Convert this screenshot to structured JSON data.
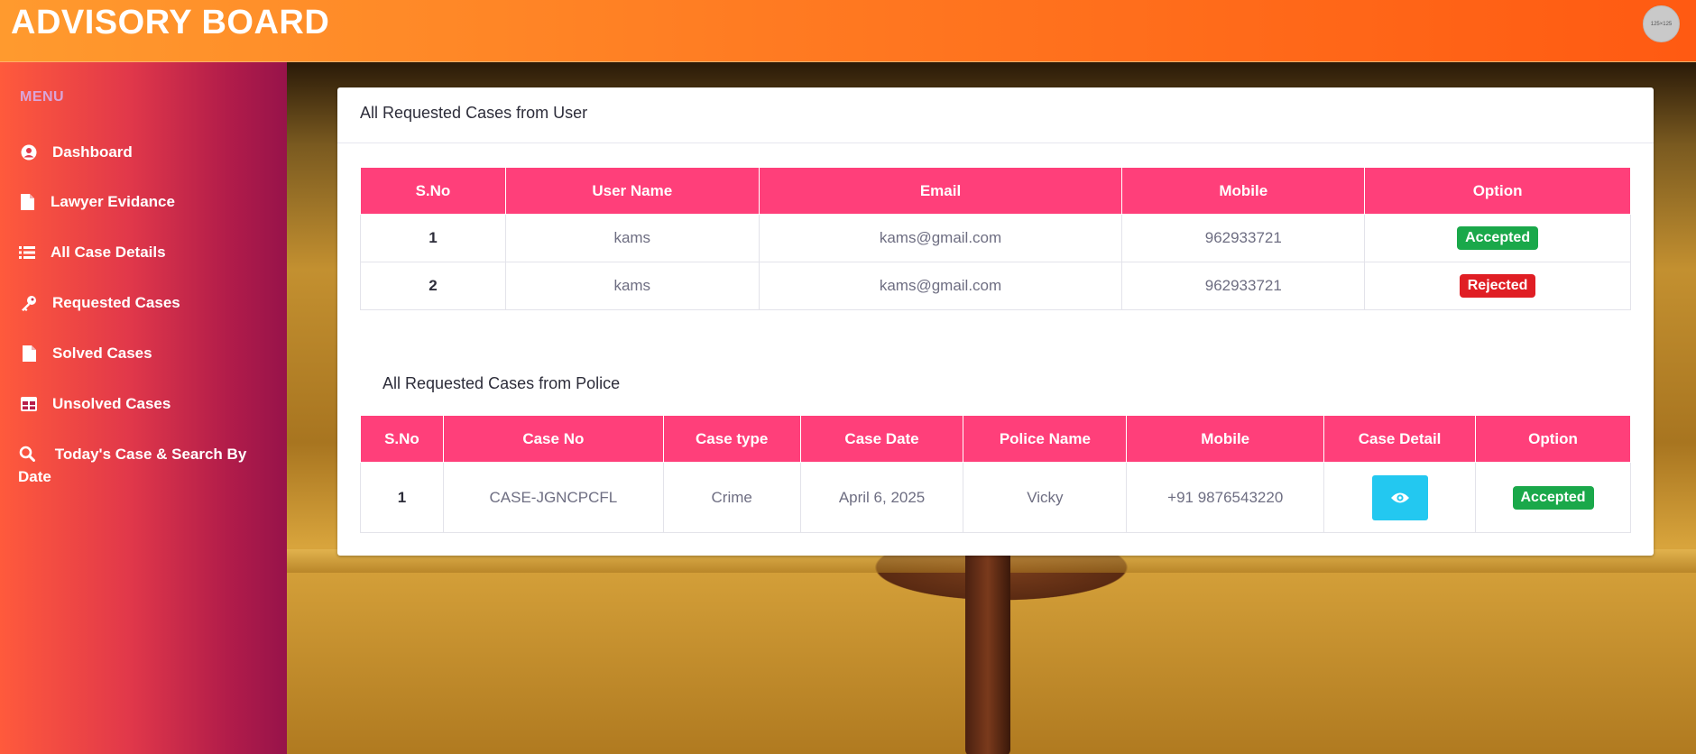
{
  "header": {
    "brand": "ADVISORY BOARD",
    "avatar_text": "125×125"
  },
  "sidebar": {
    "menu_title": "MENU",
    "items": [
      {
        "label": "Dashboard",
        "icon": "user-circle-icon"
      },
      {
        "label": "Lawyer Evidance",
        "icon": "file-icon"
      },
      {
        "label": "All Case Details",
        "icon": "list-icon"
      },
      {
        "label": "Requested Cases",
        "icon": "key-icon"
      },
      {
        "label": "Solved Cases",
        "icon": "file-icon"
      },
      {
        "label": "Unsolved Cases",
        "icon": "table-icon"
      },
      {
        "label": "Today's Case & Search By Date",
        "icon": "search-icon"
      }
    ]
  },
  "main": {
    "card_title": "All Requested Cases from User",
    "user_table": {
      "columns": [
        "S.No",
        "User Name",
        "Email",
        "Mobile",
        "Option"
      ],
      "rows": [
        {
          "sno": "1",
          "name": "kams",
          "email": "kams@gmail.com",
          "mobile": "962933721",
          "option": "Accepted",
          "option_status": "accepted"
        },
        {
          "sno": "2",
          "name": "kams",
          "email": "kams@gmail.com",
          "mobile": "962933721",
          "option": "Rejected",
          "option_status": "rejected"
        }
      ]
    },
    "police_title": "All Requested Cases from Police",
    "police_table": {
      "columns": [
        "S.No",
        "Case No",
        "Case type",
        "Case Date",
        "Police Name",
        "Mobile",
        "Case Detail",
        "Option"
      ],
      "rows": [
        {
          "sno": "1",
          "case_no": "CASE-JGNCPCFL",
          "case_type": "Crime",
          "case_date": "April 6, 2025",
          "police_name": "Vicky",
          "mobile": "+91 9876543220",
          "detail_icon": "eye-icon",
          "option": "Accepted",
          "option_status": "accepted"
        }
      ]
    }
  },
  "colors": {
    "header_gradient": [
      "#ff9a2e",
      "#ff5a12"
    ],
    "table_header": "#ff3f7a",
    "accepted": "#1aa84a",
    "rejected": "#e01e24",
    "view_button": "#23c8f0"
  }
}
